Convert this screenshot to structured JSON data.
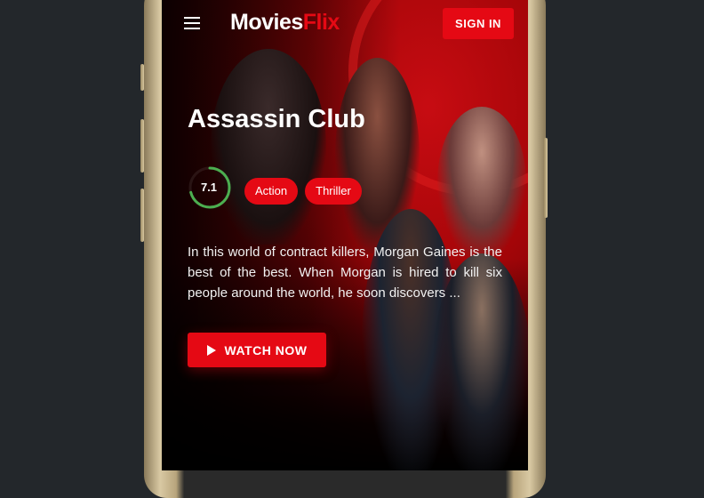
{
  "header": {
    "logo_main": "Movies",
    "logo_accent": "Flix",
    "signin_label": "SIGN IN"
  },
  "movie": {
    "title": "Assassin Club",
    "rating": "7.1",
    "rating_fraction": 0.71,
    "genres": [
      "Action",
      "Thriller"
    ],
    "description": "In this world of contract killers, Morgan Gaines is the best of the best. When Morgan is hired to kill six people around the world, he soon discovers ...",
    "watch_label": "WATCH NOW"
  },
  "colors": {
    "accent": "#e50914",
    "rating_ring": "#4caf50",
    "background": "#23272b"
  },
  "icons": {
    "menu": "hamburger-menu-icon",
    "play": "play-icon"
  }
}
